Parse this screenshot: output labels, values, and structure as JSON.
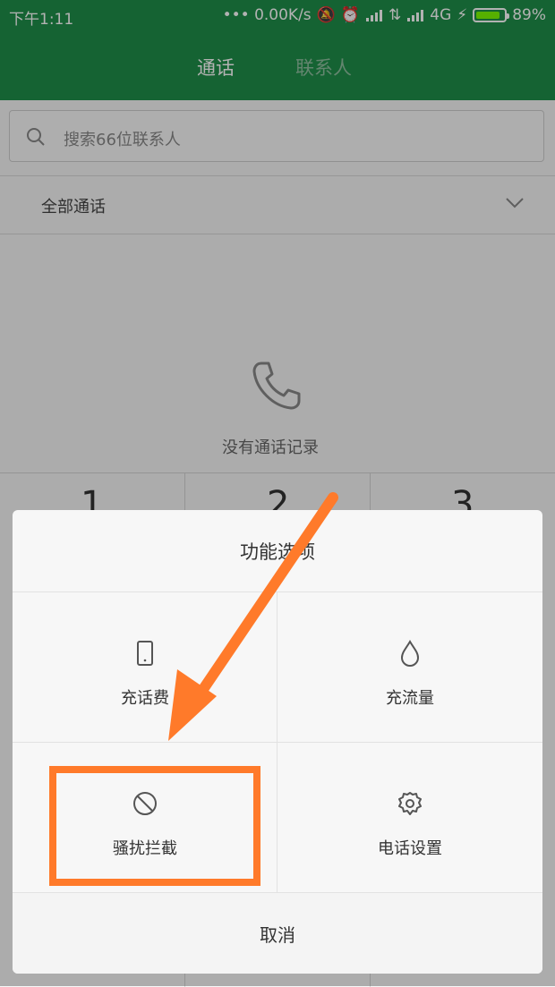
{
  "status_bar": {
    "time": "下午1:11",
    "net_speed": "••• 0.00K/s",
    "network": "4G",
    "battery": "89%"
  },
  "header": {
    "tabs": [
      {
        "label": "通话",
        "active": true
      },
      {
        "label": "联系人",
        "active": false
      }
    ],
    "color": "#1f8f4a"
  },
  "search": {
    "placeholder": "搜索66位联系人"
  },
  "filter": {
    "label": "全部通话"
  },
  "empty": {
    "text": "没有通话记录"
  },
  "dialpad": {
    "keys": [
      "1",
      "2",
      "3"
    ]
  },
  "sheet": {
    "title": "功能选项",
    "items": [
      {
        "label": "充话费",
        "icon": "phone-device-icon"
      },
      {
        "label": "充流量",
        "icon": "droplet-icon"
      },
      {
        "label": "骚扰拦截",
        "icon": "block-icon"
      },
      {
        "label": "电话设置",
        "icon": "gear-icon"
      }
    ],
    "cancel": "取消"
  },
  "annotation": {
    "color": "#ff7a2a"
  }
}
